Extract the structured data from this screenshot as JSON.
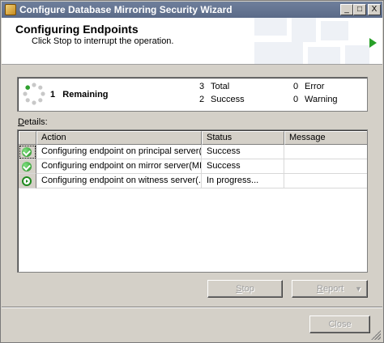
{
  "window": {
    "title": "Configure Database Mirroring Security Wizard",
    "controls": {
      "minimize": "_",
      "maximize": "□",
      "close": "X"
    }
  },
  "header": {
    "title": "Configuring Endpoints",
    "subtitle": "Click Stop to interrupt the operation."
  },
  "summary": {
    "remaining_count": "1",
    "remaining_label": "Remaining",
    "total_count": "3",
    "total_label": "Total",
    "success_count": "2",
    "success_label": "Success",
    "error_count": "0",
    "error_label": "Error",
    "warning_count": "0",
    "warning_label": "Warning"
  },
  "details": {
    "label_accel": "D",
    "label_rest": "etails:",
    "columns": [
      "",
      "Action",
      "Status",
      "Message"
    ],
    "rows": [
      {
        "icon": "success-icon",
        "action": "Configuring endpoint on principal server(...",
        "status": "Success",
        "message": ""
      },
      {
        "icon": "success-icon",
        "action": "Configuring endpoint on mirror server(MI...",
        "status": "Success",
        "message": ""
      },
      {
        "icon": "in-progress-icon",
        "action": "Configuring endpoint on witness server(...",
        "status": "In progress...",
        "message": ""
      }
    ]
  },
  "buttons": {
    "stop_accel": "S",
    "stop_rest": "top",
    "report_accel": "R",
    "report_rest": "eport",
    "report_arrow": "▼",
    "close": "Close"
  }
}
